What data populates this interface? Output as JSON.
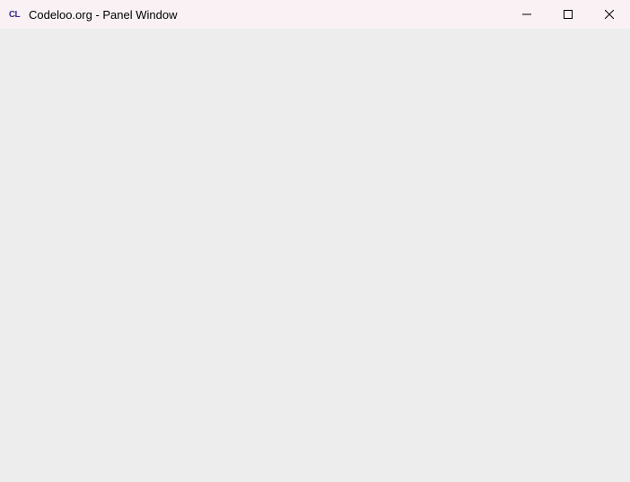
{
  "window": {
    "title": "Codeloo.org - Panel Window",
    "icon_label": "CL"
  }
}
